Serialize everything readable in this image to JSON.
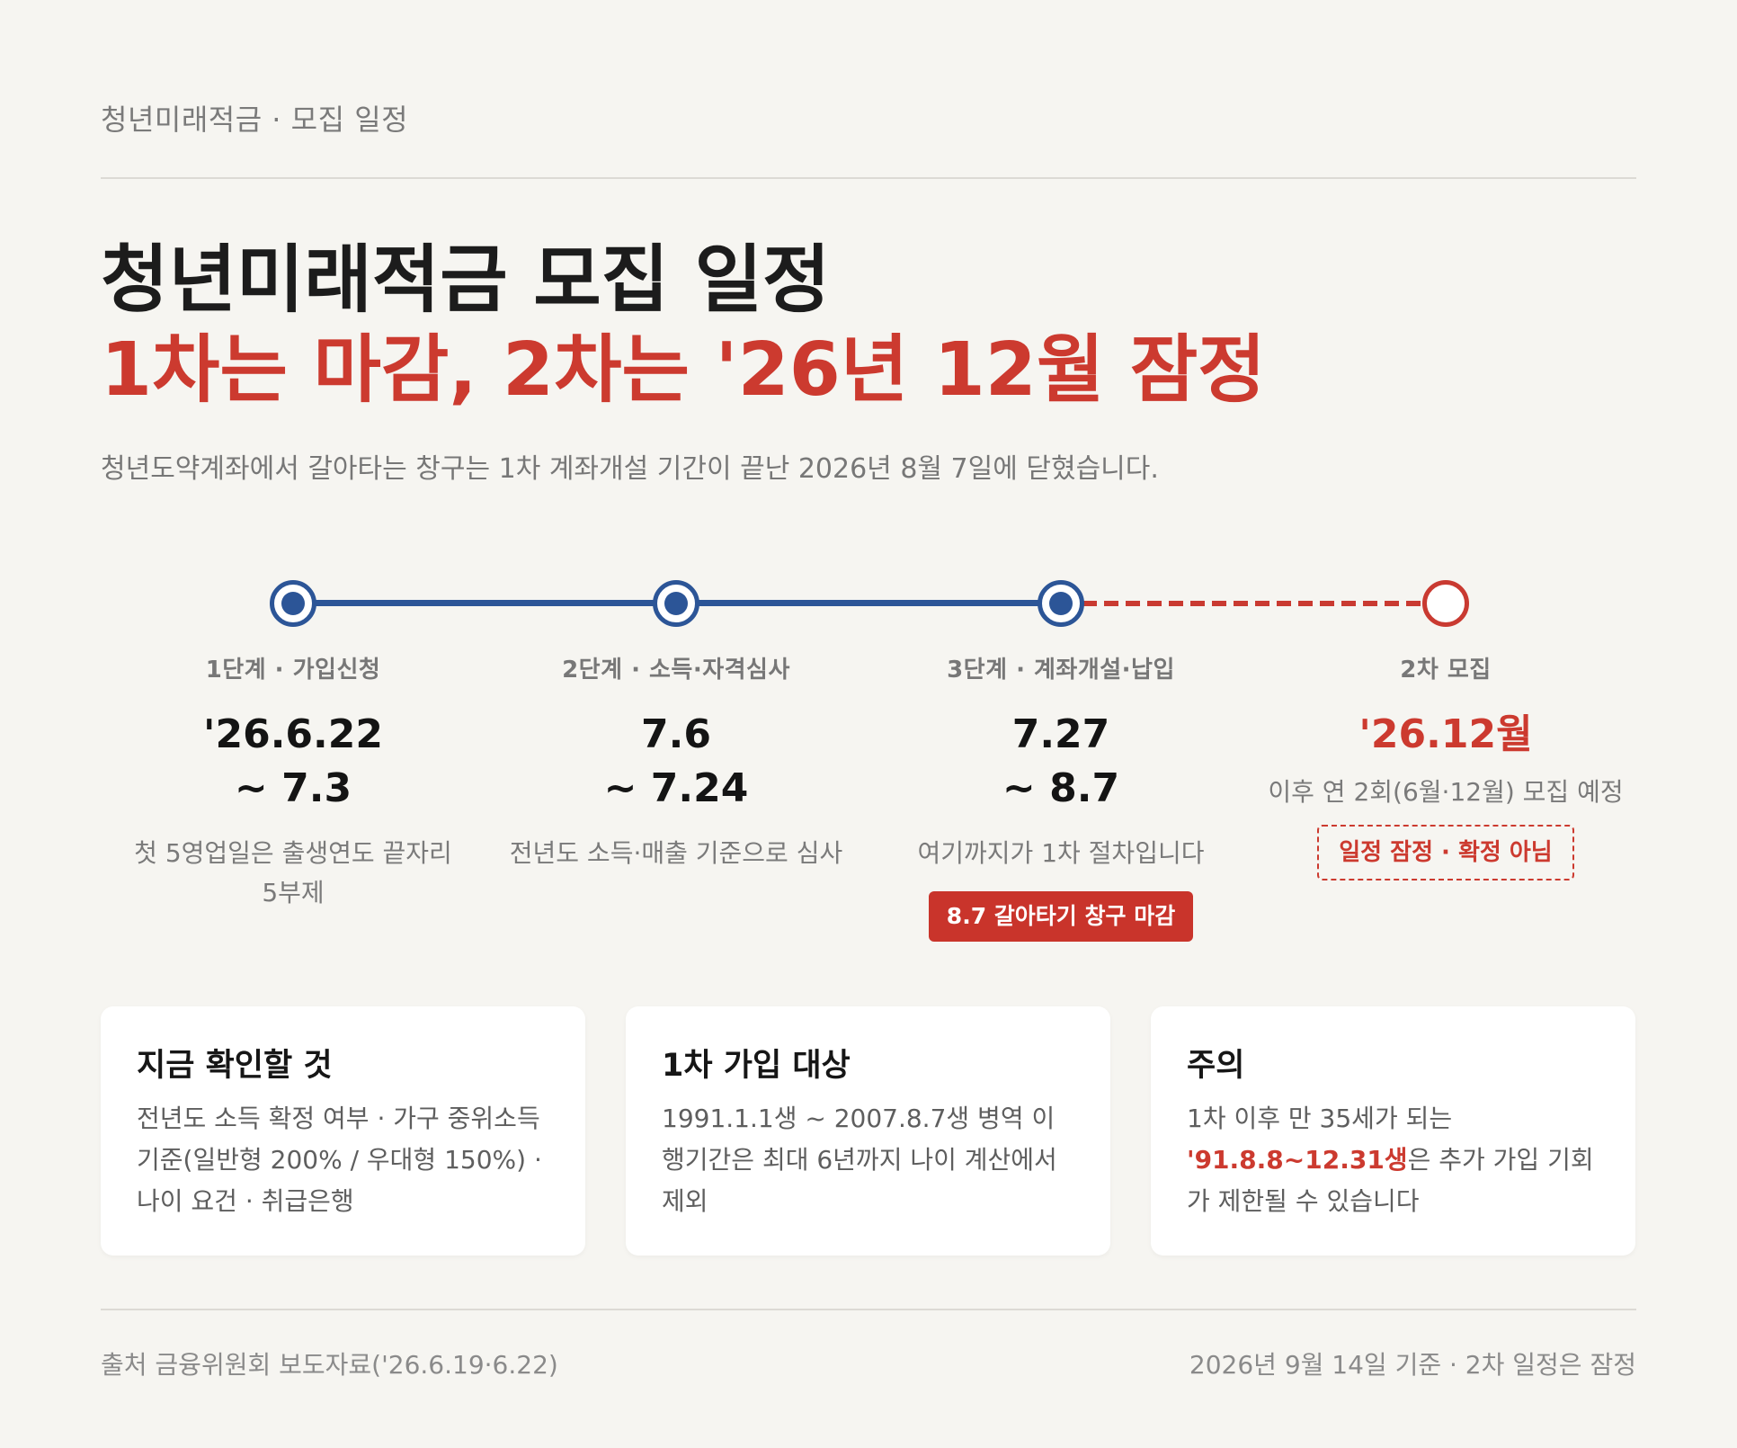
{
  "header": {
    "kicker": "청년미래적금 · 모집 일정",
    "title_line1": "청년미래적금 모집 일정",
    "title_line2": "1차는 마감, 2차는 '26년 12월 잠정",
    "subtitle": "청년도약계좌에서 갈아타는 창구는 1차 계좌개설 기간이 끝난 2026년 8월 7일에 닫혔습니다."
  },
  "timeline": {
    "colors": {
      "done": "#2c5597",
      "pending": "#c93a31"
    },
    "steps": [
      {
        "label": "1단계 · 가입신청",
        "date_line1": "'26.6.22",
        "date_line2": "~ 7.3",
        "note": "첫 5영업일은 출생연도 끝자리 5부제",
        "status": "done"
      },
      {
        "label": "2단계 · 소득·자격심사",
        "date_line1": "7.6",
        "date_line2": "~ 7.24",
        "note": "전년도 소득·매출 기준으로 심사",
        "status": "done"
      },
      {
        "label": "3단계 · 계좌개설·납입",
        "date_line1": "7.27",
        "date_line2": "~ 8.7",
        "note": "여기까지가 1차 절차입니다",
        "badge": "8.7 갈아타기 창구 마감",
        "status": "done"
      },
      {
        "label": "2차 모집",
        "date_line1": "'26.12월",
        "note": "이후 연 2회(6월·12월) 모집 예정",
        "badge": "일정 잠정 · 확정 아님",
        "status": "pending"
      }
    ]
  },
  "cards": [
    {
      "title": "지금 확인할 것",
      "body": "전년도 소득 확정 여부 · 가구 중위소득 기준(일반형 200% / 우대형 150%) · 나이 요건 · 취급은행"
    },
    {
      "title": "1차 가입 대상",
      "body": "1991.1.1생 ~ 2007.8.7생 병역 이행기간은 최대 6년까지 나이 계산에서 제외"
    },
    {
      "title": "주의",
      "body_pre": "1차 이후 만 35세가 되는",
      "body_highlight": "'91.8.8~12.31생",
      "body_post": "은 추가 가입 기회가 제한될 수 있습니다"
    }
  ],
  "footer": {
    "source": "출처 금융위원회 보도자료('26.6.19·6.22)",
    "asof": "2026년 9월 14일 기준 · 2차 일정은 잠정"
  }
}
